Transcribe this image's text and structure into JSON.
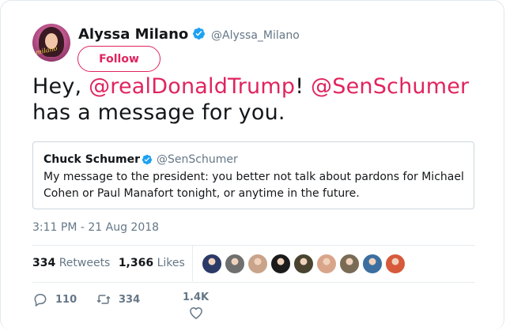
{
  "author": {
    "name": "Alyssa Milano",
    "handle": "@Alyssa_Milano",
    "follow_label": "Follow"
  },
  "tweet": {
    "text_prefix": "Hey, ",
    "mention1": "@realDonaldTrump",
    "text_mid": "! ",
    "mention2": "@SenSchumer",
    "text_suffix": "has a message for you."
  },
  "quoted_tweet": {
    "name": "Chuck Schumer",
    "handle": "@SenSchumer",
    "text": "My message to the president: you better not talk about pardons for Michael Cohen or Paul Manafort tonight, or anytime in the future."
  },
  "timestamp": "3:11 PM - 21 Aug 2018",
  "stats": {
    "retweets_count": "334",
    "retweets_label": "Retweets",
    "likes_count": "1,366",
    "likes_label": "Likes"
  },
  "actions": {
    "reply_count": "110",
    "retweet_count": "334",
    "like_count": "1.4K"
  },
  "colors": {
    "accent": "#e0245e",
    "verified": "#1da1f2",
    "muted": "#657786"
  },
  "liker_avatar_colors": [
    "#2b3a67",
    "#6f6f6f",
    "#c9a48a",
    "#1b1b1b",
    "#4a4330",
    "#d9a58a",
    "#7a6b55",
    "#3b6fa0",
    "#d65a3b"
  ]
}
